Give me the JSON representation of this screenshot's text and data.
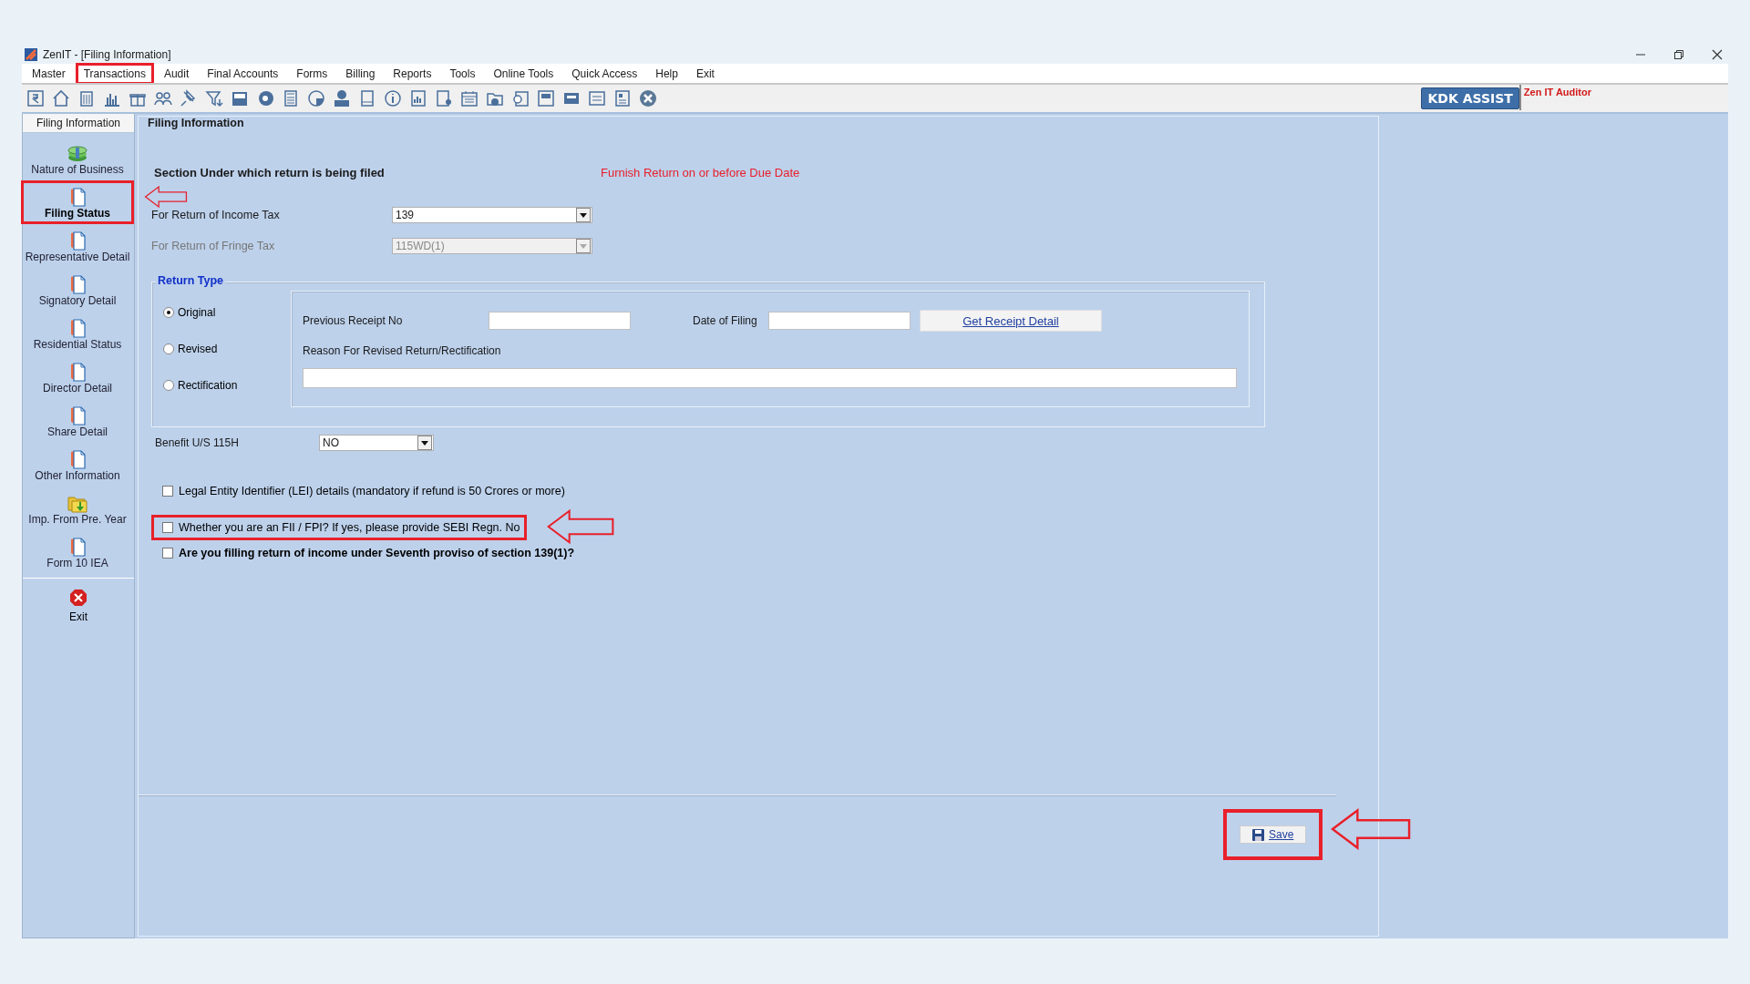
{
  "window": {
    "title": "ZenIT - [Filing Information]"
  },
  "menu": [
    {
      "label": "Master",
      "callout": false
    },
    {
      "label": "Transactions",
      "callout": true
    },
    {
      "label": "Audit",
      "callout": false
    },
    {
      "label": "Final Accounts",
      "callout": false
    },
    {
      "label": "Forms",
      "callout": false
    },
    {
      "label": "Billing",
      "callout": false
    },
    {
      "label": "Reports",
      "callout": false
    },
    {
      "label": "Tools",
      "callout": false
    },
    {
      "label": "Online Tools",
      "callout": false
    },
    {
      "label": "Quick Access",
      "callout": false
    },
    {
      "label": "Help",
      "callout": false
    },
    {
      "label": "Exit",
      "callout": false
    }
  ],
  "toolbar": {
    "assist_button": "KDK ASSIST",
    "product_label": "Zen IT Auditor"
  },
  "sidebar": {
    "header": "Filing Information",
    "items": [
      {
        "label": "Nature of Business",
        "kind": "money",
        "selected": false,
        "callout": false
      },
      {
        "label": "Filing Status",
        "kind": "document",
        "selected": true,
        "callout": true
      },
      {
        "label": "Representative Detail",
        "kind": "document",
        "selected": false,
        "callout": false
      },
      {
        "label": "Signatory Detail",
        "kind": "document",
        "selected": false,
        "callout": false
      },
      {
        "label": "Residential Status",
        "kind": "document",
        "selected": false,
        "callout": false
      },
      {
        "label": "Director Detail",
        "kind": "document",
        "selected": false,
        "callout": false
      },
      {
        "label": "Share Detail",
        "kind": "document",
        "selected": false,
        "callout": false
      },
      {
        "label": "Other Information",
        "kind": "document",
        "selected": false,
        "callout": false
      },
      {
        "label": "Imp. From Pre. Year",
        "kind": "folder",
        "selected": false,
        "callout": false
      },
      {
        "label": "Form 10 IEA",
        "kind": "document",
        "selected": false,
        "callout": false
      }
    ],
    "exit": {
      "label": "Exit"
    }
  },
  "form": {
    "title": "Filing Information",
    "section_heading": "Section Under which return is being filed",
    "notice": "Furnish Return on or before Due Date",
    "selects": [
      {
        "label": "For Return of Income Tax",
        "value": "139",
        "disabled": false
      },
      {
        "label": "For Return of Fringe Tax",
        "value": "115WD(1)",
        "disabled": true
      }
    ],
    "return_type": {
      "title": "Return Type",
      "options": [
        {
          "label": "Original",
          "selected": true
        },
        {
          "label": "Revised",
          "selected": false
        },
        {
          "label": "Rectification",
          "selected": false
        }
      ],
      "previous_receipt_label": "Previous Receipt No",
      "date_of_filing_label": "Date of Filing",
      "receipt_button": "Get Receipt Detail",
      "reason_label": "Reason For Revised Return/Rectification"
    },
    "benefit": {
      "label": "Benefit U/S 115H",
      "value": "NO"
    },
    "checkboxes": [
      {
        "label": "Legal Entity Identifier (LEI) details (mandatory if refund is 50 Crores or more)",
        "checked": false,
        "bold": false,
        "callout": false
      },
      {
        "label": "Whether you are an FII / FPI?  If yes, please provide SEBI Regn. No",
        "checked": false,
        "bold": false,
        "callout": true
      },
      {
        "label": "Are you filling return of income under Seventh proviso of section 139(1)?",
        "checked": false,
        "bold": true,
        "callout": false
      }
    ],
    "save_button": {
      "label": "Save",
      "callout": true
    }
  },
  "arrows": {
    "sidebar": true,
    "checkbox": true,
    "save": true
  }
}
